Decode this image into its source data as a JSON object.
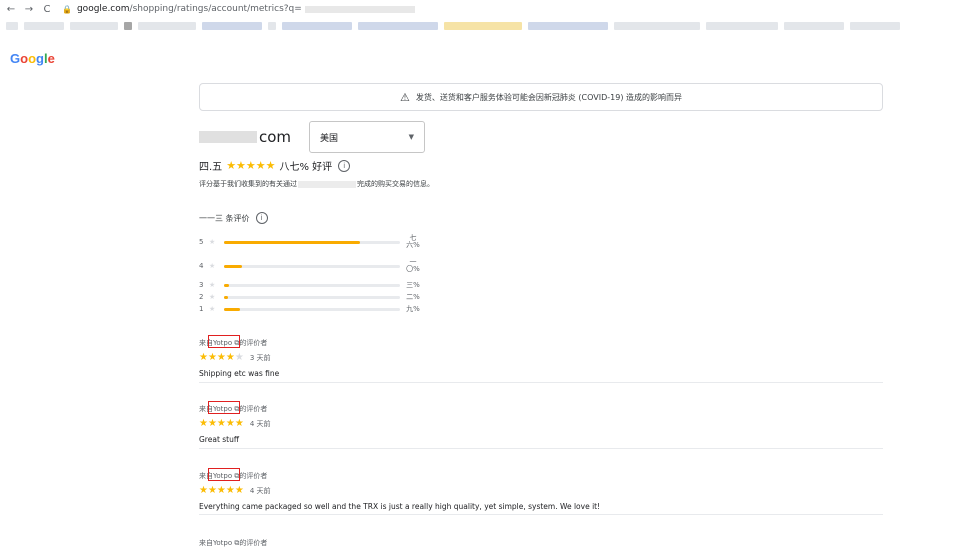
{
  "browser": {
    "nav": {
      "back": "←",
      "forward": "→",
      "reload": "C"
    },
    "url_host": "google.com",
    "url_path": "/shopping/ratings/account/metrics?q="
  },
  "logo": "Google",
  "notice": {
    "icon": "warning-icon",
    "text": "发货、送货和客户服务体验可能会因新冠肺炎 (COVID-19) 造成的影响而异"
  },
  "store": {
    "domain_suffix": "com",
    "country": "美国"
  },
  "summary": {
    "score": "四.五",
    "stars": "★★★★★",
    "positive": "八七% 好评",
    "basis_prefix": "评分基于我们收集到的有关通过",
    "basis_suffix": "完成的购买交易的信息。",
    "review_count": "一一三 条评价"
  },
  "distribution": [
    {
      "star": "5",
      "fraction": 0.77,
      "pct": "七六%"
    },
    {
      "star": "4",
      "fraction": 0.1,
      "pct": "一〇%"
    },
    {
      "star": "3",
      "fraction": 0.03,
      "pct": "三%"
    },
    {
      "star": "2",
      "fraction": 0.02,
      "pct": "二%"
    },
    {
      "star": "1",
      "fraction": 0.09,
      "pct": "九%"
    }
  ],
  "reviews": [
    {
      "source": "来自Yotpo ⧉的评价者",
      "stars_filled": "★★★★",
      "stars_empty": "★",
      "when": "3 天前",
      "text": "Shipping etc was fine"
    },
    {
      "source": "来自Yotpo ⧉的评价者",
      "stars_filled": "★★★★★",
      "stars_empty": "",
      "when": "4 天前",
      "text": "Great stuff"
    },
    {
      "source": "来自Yotpo ⧉的评价者",
      "stars_filled": "★★★★★",
      "stars_empty": "",
      "when": "4 天前",
      "text": "Everything came packaged so well and the TRX is just a really high quality, yet simple, system. We love it!"
    },
    {
      "source": "来自Yotpo ⧉的评价者",
      "stars_filled": "",
      "stars_empty": "",
      "when": "",
      "text": ""
    }
  ],
  "colors": {
    "star": "#fbbc05",
    "bar_fill": "#f9ab00",
    "highlight": "#e02020"
  }
}
